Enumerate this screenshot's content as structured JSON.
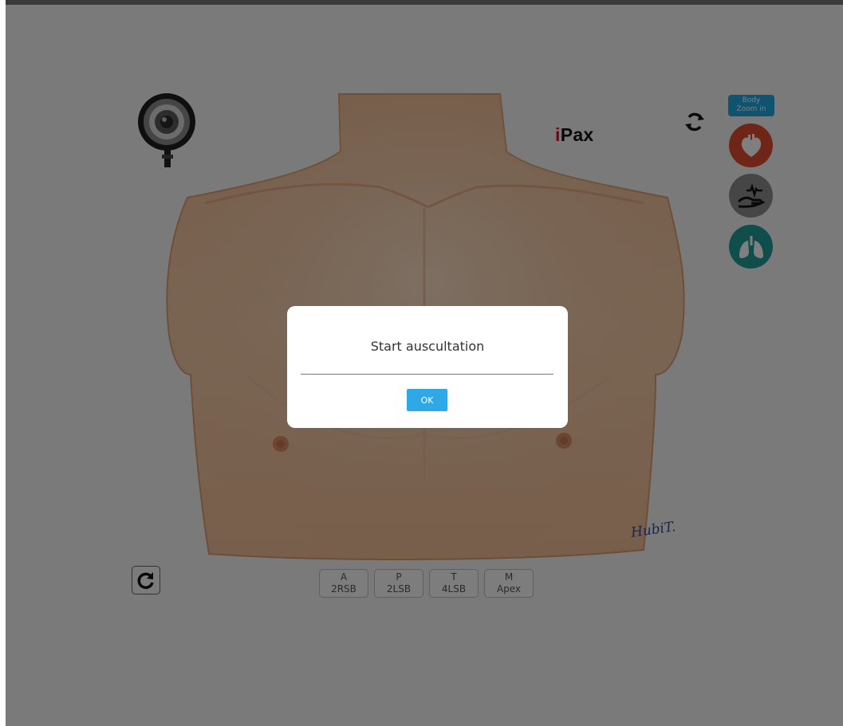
{
  "brand": {
    "prefix": "i",
    "name": "Pax"
  },
  "signature": "HubiT.",
  "toolbar": {
    "zoom_label_line1": "Body",
    "zoom_label_line2": "Zoom in",
    "icons": [
      "stethoscope-icon",
      "swap-icon",
      "heart-icon",
      "hand-pulse-icon",
      "lungs-icon",
      "reset-icon"
    ]
  },
  "points": [
    {
      "letter": "A",
      "location": "2RSB"
    },
    {
      "letter": "P",
      "location": "2LSB"
    },
    {
      "letter": "T",
      "location": "4LSB"
    },
    {
      "letter": "M",
      "location": "Apex"
    }
  ],
  "modal": {
    "title": "Start auscultation",
    "ok_label": "OK"
  },
  "colors": {
    "accent": "#2ea8e6",
    "heart": "#e04c2e",
    "pulse": "#8c8c8c",
    "lungs": "#1f9d98",
    "skin": "#f2c9a4"
  }
}
